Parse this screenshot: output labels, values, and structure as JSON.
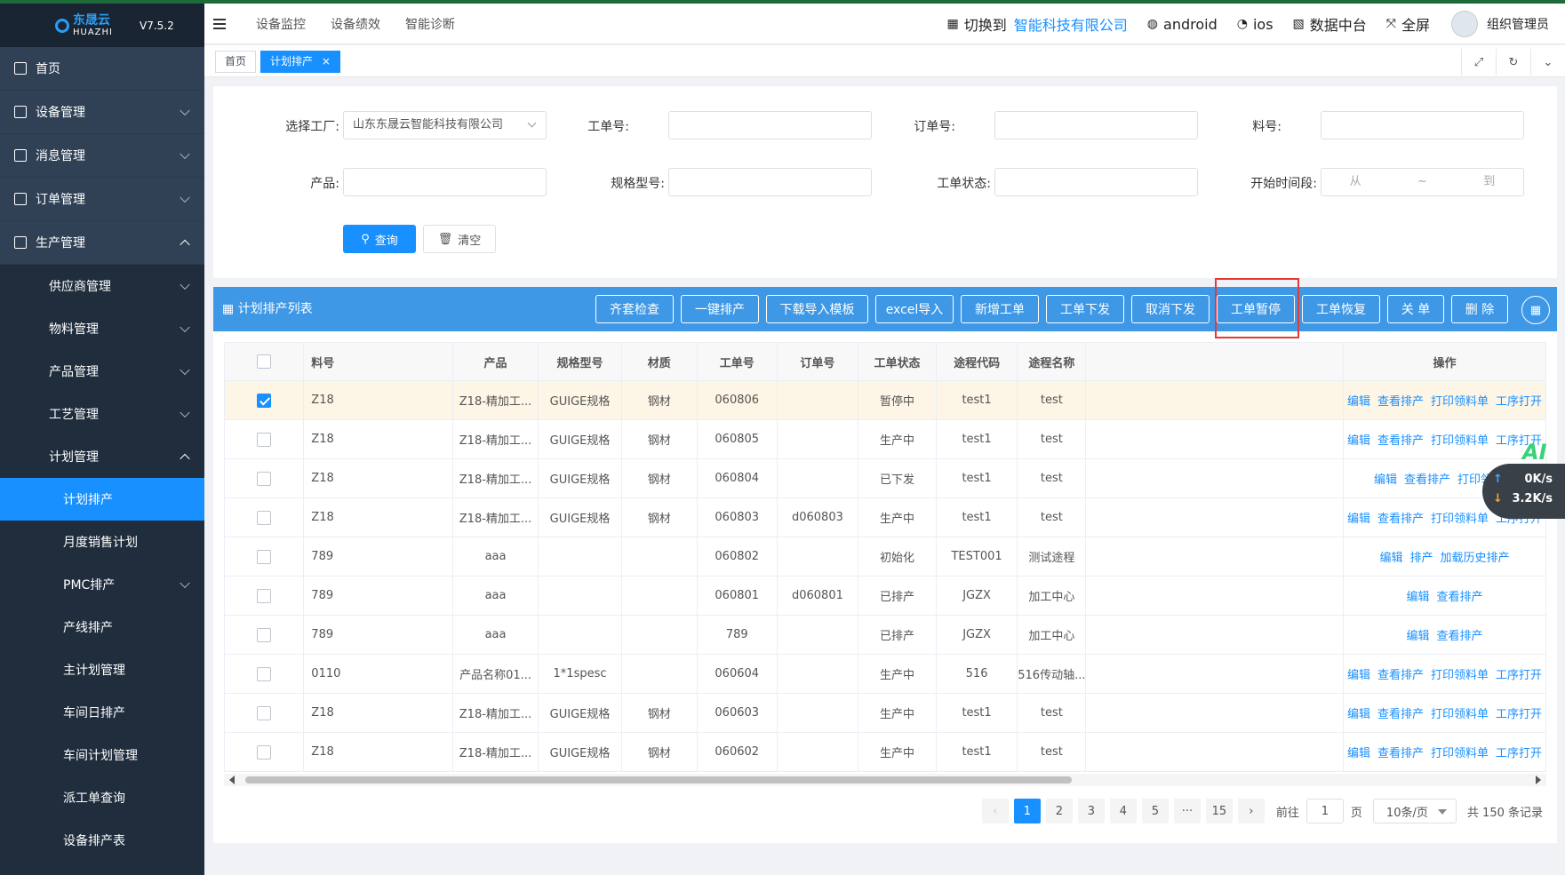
{
  "app": {
    "logo_name": "东晟云",
    "logo_sub": "HUAZHI",
    "version": "V7.5.2"
  },
  "sidebar": {
    "items": [
      {
        "label": "首页"
      },
      {
        "label": "设备管理"
      },
      {
        "label": "消息管理"
      },
      {
        "label": "订单管理"
      },
      {
        "label": "生产管理"
      }
    ],
    "sub_items": [
      {
        "label": "供应商管理"
      },
      {
        "label": "物料管理"
      },
      {
        "label": "产品管理"
      },
      {
        "label": "工艺管理"
      },
      {
        "label": "计划管理"
      }
    ],
    "plan_items": [
      {
        "label": "计划排产"
      },
      {
        "label": "月度销售计划"
      },
      {
        "label": "PMC排产"
      },
      {
        "label": "产线排产"
      },
      {
        "label": "主计划管理"
      },
      {
        "label": "车间日排产"
      },
      {
        "label": "车间计划管理"
      },
      {
        "label": "派工单查询"
      },
      {
        "label": "设备排产表"
      }
    ]
  },
  "header": {
    "nav": [
      "设备监控",
      "设备绩效",
      "智能诊断"
    ],
    "switch_label": "切换到",
    "company": "智能科技有限公司",
    "android": "android",
    "ios": "ios",
    "data_center": "数据中台",
    "fullscreen": "全屏",
    "user": "组织管理员"
  },
  "tags": {
    "home": "首页",
    "current": "计划排产"
  },
  "search": {
    "factory_label": "选择工厂:",
    "factory_value": "山东东晟云智能科技有限公司",
    "work_no_label": "工单号:",
    "order_no_label": "订单号:",
    "material_no_label": "料号:",
    "product_label": "产品:",
    "spec_label": "规格型号:",
    "status_label": "工单状态:",
    "period_label": "开始时间段:",
    "period_from": "从",
    "period_sep": "~",
    "period_to": "到",
    "query_btn": "查询",
    "clear_btn": "清空"
  },
  "table_bar": {
    "title": "计划排产列表",
    "buttons": [
      "齐套检查",
      "一键排产",
      "下载导入模板",
      "excel导入",
      "新增工单",
      "工单下发",
      "取消下发",
      "工单暂停",
      "工单恢复",
      "关 单",
      "删 除"
    ]
  },
  "table": {
    "headers": [
      "料号",
      "产品",
      "规格型号",
      "材质",
      "工单号",
      "订单号",
      "工单状态",
      "途程代码",
      "途程名称",
      "操作"
    ],
    "rows": [
      {
        "material": "Z18",
        "product": "Z18-精加工...",
        "spec": "GUIGE规格",
        "texture": "钢材",
        "work_no": "060806",
        "order_no": "",
        "status": "暂停中",
        "route_code": "test1",
        "route_name": "test",
        "ops": [
          "编辑",
          "查看排产",
          "打印领料单",
          "工序打开"
        ],
        "checked": true
      },
      {
        "material": "Z18",
        "product": "Z18-精加工...",
        "spec": "GUIGE规格",
        "texture": "钢材",
        "work_no": "060805",
        "order_no": "",
        "status": "生产中",
        "route_code": "test1",
        "route_name": "test",
        "ops": [
          "编辑",
          "查看排产",
          "打印领料单",
          "工序打开"
        ]
      },
      {
        "material": "Z18",
        "product": "Z18-精加工...",
        "spec": "GUIGE规格",
        "texture": "钢材",
        "work_no": "060804",
        "order_no": "",
        "status": "已下发",
        "route_code": "test1",
        "route_name": "test",
        "ops": [
          "编辑",
          "查看排产",
          "打印领料单"
        ]
      },
      {
        "material": "Z18",
        "product": "Z18-精加工...",
        "spec": "GUIGE规格",
        "texture": "钢材",
        "work_no": "060803",
        "order_no": "d060803",
        "status": "生产中",
        "route_code": "test1",
        "route_name": "test",
        "ops": [
          "编辑",
          "查看排产",
          "打印领料单",
          "工序打开"
        ]
      },
      {
        "material": "789",
        "product": "aaa",
        "spec": "",
        "texture": "",
        "work_no": "060802",
        "order_no": "",
        "status": "初始化",
        "route_code": "TEST001",
        "route_name": "测试途程",
        "ops": [
          "编辑",
          "排产",
          "加载历史排产"
        ]
      },
      {
        "material": "789",
        "product": "aaa",
        "spec": "",
        "texture": "",
        "work_no": "060801",
        "order_no": "d060801",
        "status": "已排产",
        "route_code": "JGZX",
        "route_name": "加工中心",
        "ops": [
          "编辑",
          "查看排产"
        ]
      },
      {
        "material": "789",
        "product": "aaa",
        "spec": "",
        "texture": "",
        "work_no": "789",
        "order_no": "",
        "status": "已排产",
        "route_code": "JGZX",
        "route_name": "加工中心",
        "ops": [
          "编辑",
          "查看排产"
        ]
      },
      {
        "material": "0110",
        "product": "产品名称01...",
        "spec": "1*1spesc",
        "texture": "",
        "work_no": "060604",
        "order_no": "",
        "status": "生产中",
        "route_code": "516",
        "route_name": "516传动轴...",
        "ops": [
          "编辑",
          "查看排产",
          "打印领料单",
          "工序打开"
        ]
      },
      {
        "material": "Z18",
        "product": "Z18-精加工...",
        "spec": "GUIGE规格",
        "texture": "钢材",
        "work_no": "060603",
        "order_no": "",
        "status": "生产中",
        "route_code": "test1",
        "route_name": "test",
        "ops": [
          "编辑",
          "查看排产",
          "打印领料单",
          "工序打开"
        ]
      },
      {
        "material": "Z18",
        "product": "Z18-精加工...",
        "spec": "GUIGE规格",
        "texture": "钢材",
        "work_no": "060602",
        "order_no": "",
        "status": "生产中",
        "route_code": "test1",
        "route_name": "test",
        "ops": [
          "编辑",
          "查看排产",
          "打印领料单",
          "工序打开"
        ]
      }
    ]
  },
  "pagination": {
    "pages": [
      "1",
      "2",
      "3",
      "4",
      "5",
      "···",
      "15"
    ],
    "goto_label": "前往",
    "goto_value": "1",
    "page_unit": "页",
    "page_size": "10条/页",
    "total": "共 150 条记录"
  },
  "net_widget": {
    "ai": "AI",
    "up": "0K/s",
    "down": "3.2K/s"
  },
  "colors": {
    "primary": "#1890ff",
    "sidebar": "#1f2d3d",
    "table_bar": "#3e98e6",
    "highlight": "#e53935"
  }
}
